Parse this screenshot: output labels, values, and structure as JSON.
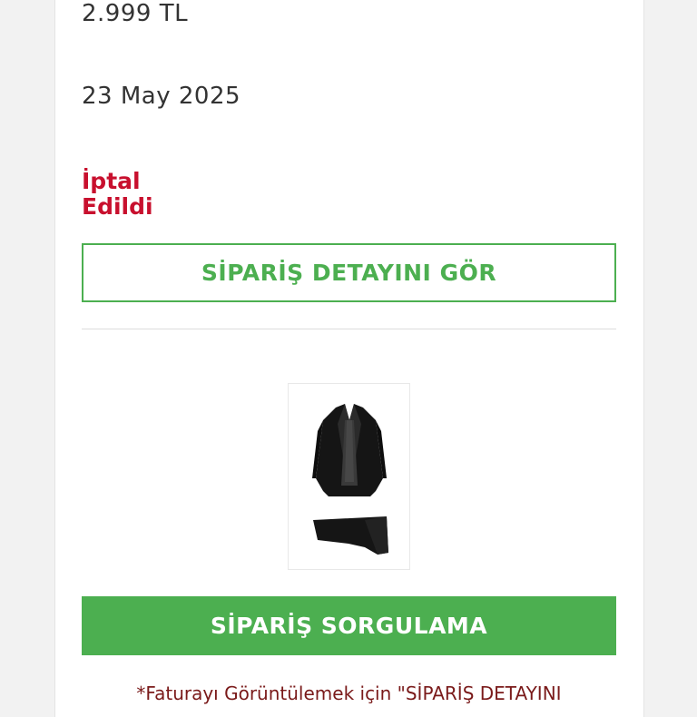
{
  "order": {
    "price": "2.999 TL",
    "date": "23 May 2025",
    "status": "İptal Edildi",
    "status_color": "#c8102e"
  },
  "buttons": {
    "order_detail": "SİPARİŞ DETAYINI GÖR",
    "order_query": "SİPARİŞ SORGULAMA"
  },
  "product": {
    "image_icon": "suit-icon"
  },
  "note": "*Faturayı Görüntülemek için \"SİPARİŞ DETAYINI",
  "colors": {
    "accent_green": "#4caf50",
    "cancel_red": "#c8102e",
    "note_red": "#7a1a1a"
  }
}
